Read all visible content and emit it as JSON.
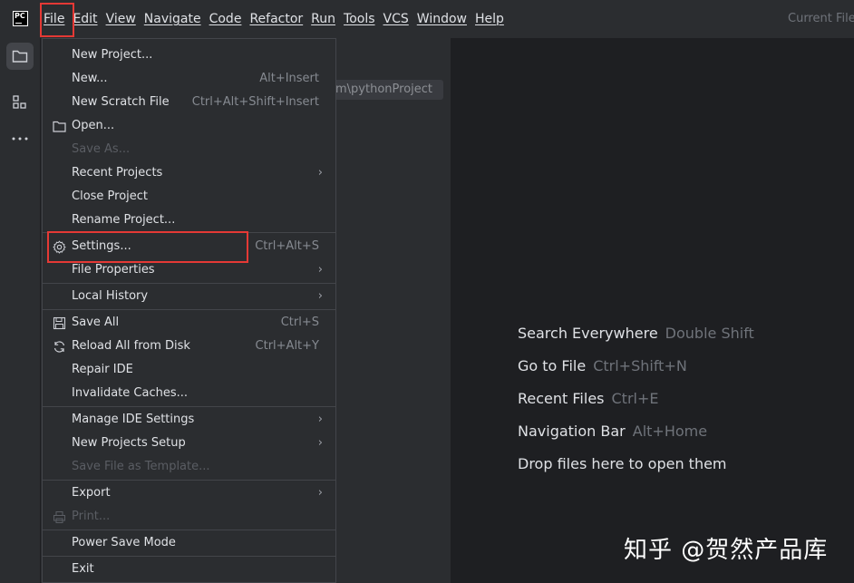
{
  "menubar": {
    "items": [
      {
        "label": "File",
        "active": true
      },
      {
        "label": "Edit"
      },
      {
        "label": "View"
      },
      {
        "label": "Navigate"
      },
      {
        "label": "Code"
      },
      {
        "label": "Refactor"
      },
      {
        "label": "Run"
      },
      {
        "label": "Tools"
      },
      {
        "label": "VCS"
      },
      {
        "label": "Window"
      },
      {
        "label": "Help"
      }
    ],
    "current_file": "Current File",
    "logo_text": "PC"
  },
  "project_pane": {
    "path_chip": "m\\pythonProject"
  },
  "file_menu": {
    "new_project": "New Project...",
    "new": "New...",
    "new_shortcut": "Alt+Insert",
    "new_scratch": "New Scratch File",
    "new_scratch_shortcut": "Ctrl+Alt+Shift+Insert",
    "open": "Open...",
    "save_as": "Save As...",
    "recent_projects": "Recent Projects",
    "close_project": "Close Project",
    "rename_project": "Rename Project...",
    "settings": "Settings...",
    "settings_shortcut": "Ctrl+Alt+S",
    "file_properties": "File Properties",
    "local_history": "Local History",
    "save_all": "Save All",
    "save_all_shortcut": "Ctrl+S",
    "reload": "Reload All from Disk",
    "reload_shortcut": "Ctrl+Alt+Y",
    "repair_ide": "Repair IDE",
    "invalidate_caches": "Invalidate Caches...",
    "manage_ide_settings": "Manage IDE Settings",
    "new_projects_setup": "New Projects Setup",
    "save_file_as_template": "Save File as Template...",
    "export": "Export",
    "print": "Print...",
    "power_save_mode": "Power Save Mode",
    "exit": "Exit",
    "submenu_arrow": "›"
  },
  "editor_hints": [
    {
      "label": "Search Everywhere",
      "shortcut": "Double Shift"
    },
    {
      "label": "Go to File",
      "shortcut": "Ctrl+Shift+N"
    },
    {
      "label": "Recent Files",
      "shortcut": "Ctrl+E"
    },
    {
      "label": "Navigation Bar",
      "shortcut": "Alt+Home"
    },
    {
      "label": "Drop files here to open them",
      "shortcut": ""
    }
  ],
  "watermark": "知乎 @贺然产品库",
  "colors": {
    "highlight_red": "#e53935",
    "menu_bg": "#2b2d30",
    "editor_bg": "#1e1f22"
  }
}
